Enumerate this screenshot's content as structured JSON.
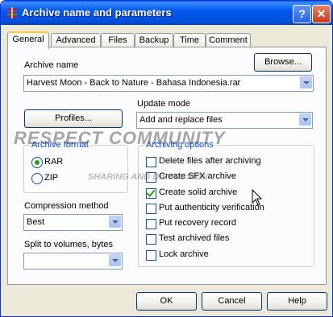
{
  "window": {
    "title": "Archive name and parameters",
    "help_label": "?",
    "close_label": "✕"
  },
  "tabs": [
    {
      "label": "General",
      "active": true
    },
    {
      "label": "Advanced"
    },
    {
      "label": "Files"
    },
    {
      "label": "Backup"
    },
    {
      "label": "Time"
    },
    {
      "label": "Comment"
    }
  ],
  "archive_name": {
    "label": "Archive name",
    "value": "Harvest Moon - Back to Nature - Bahasa Indonesia.rar",
    "browse_label": "Browse..."
  },
  "profiles_label": "Profiles...",
  "update_mode": {
    "label": "Update mode",
    "value": "Add and replace files"
  },
  "archive_format": {
    "title": "Archive format",
    "options": [
      {
        "label": "RAR",
        "selected": true
      },
      {
        "label": "ZIP",
        "selected": false
      }
    ]
  },
  "archiving_options": {
    "title": "Archiving options",
    "items": [
      {
        "label": "Delete files after archiving",
        "checked": false
      },
      {
        "label": "Create SFX archive",
        "checked": false
      },
      {
        "label": "Create solid archive",
        "checked": true
      },
      {
        "label": "Put authenticity verification",
        "checked": false
      },
      {
        "label": "Put recovery record",
        "checked": false
      },
      {
        "label": "Test archived files",
        "checked": false
      },
      {
        "label": "Lock archive",
        "checked": false
      }
    ]
  },
  "compression": {
    "label": "Compression method",
    "value": "Best"
  },
  "split": {
    "label": "Split to volumes, bytes",
    "value": ""
  },
  "buttons": {
    "ok": "OK",
    "cancel": "Cancel",
    "help": "Help"
  },
  "watermark": {
    "text": "RESPECT COMMUNITY",
    "sub": "SHARING AND DISCUSSION"
  }
}
